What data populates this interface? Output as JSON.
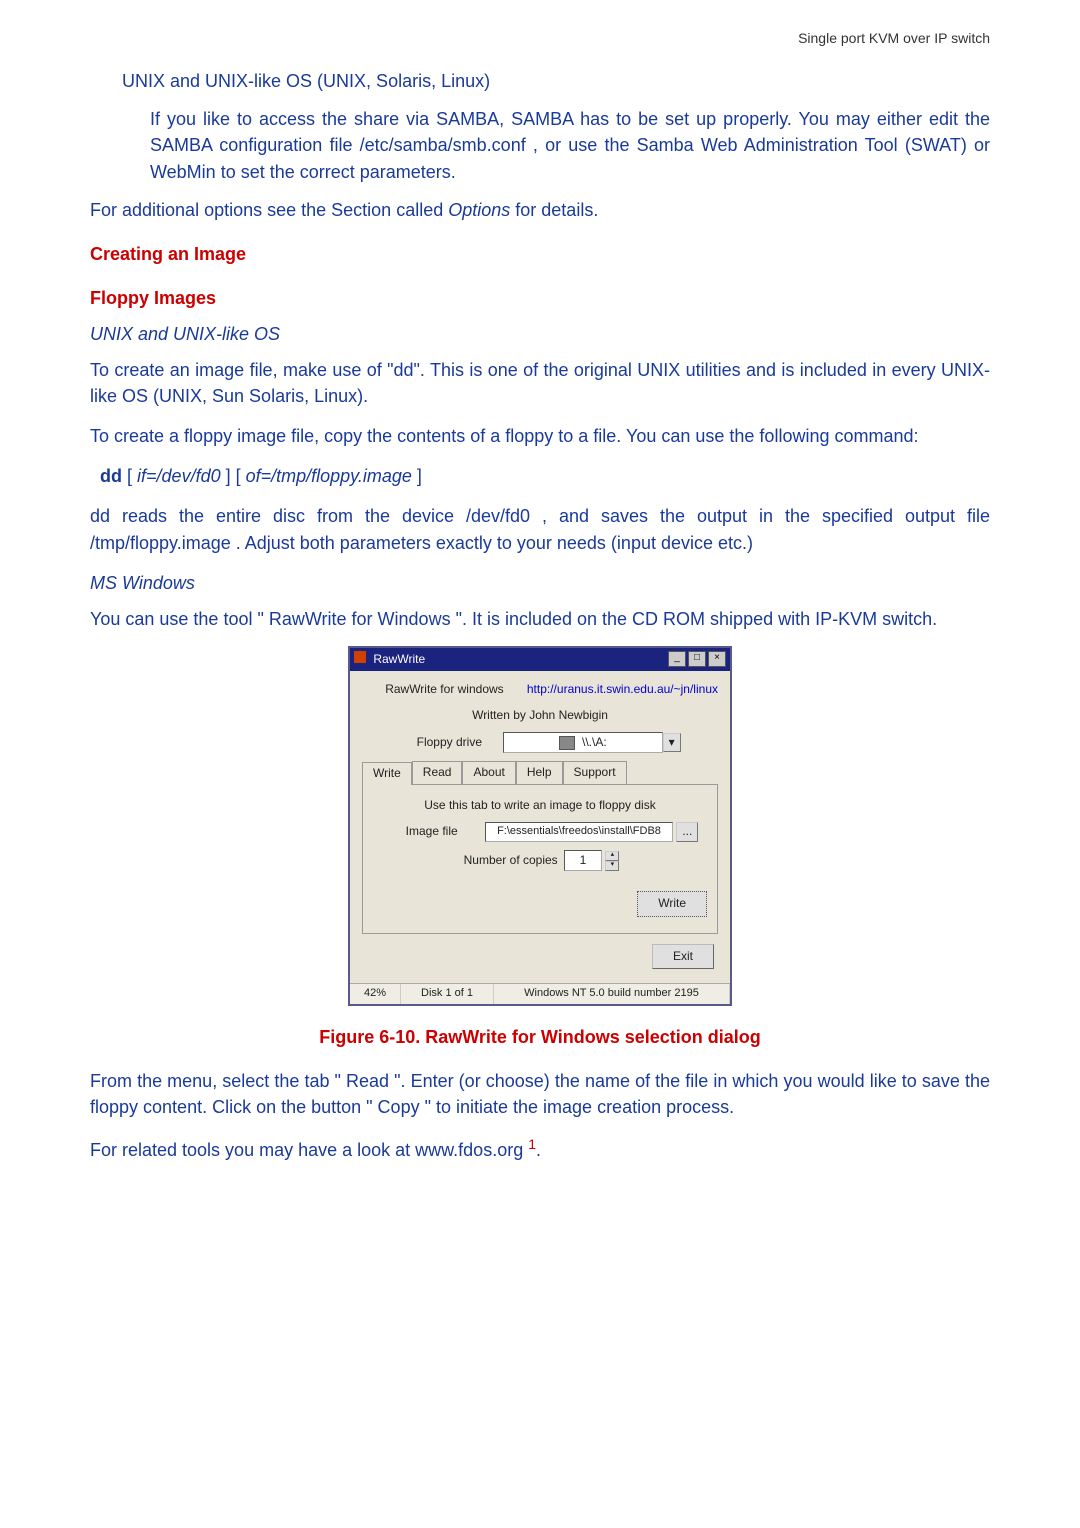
{
  "header": "Single port KVM over IP switch",
  "unix_heading": "UNIX and UNIX-like OS (UNIX, Solaris, Linux)",
  "samba_para": "If you like to access the share via SAMBA, SAMBA has to be set up properly. You may either edit the SAMBA configuration file /etc/samba/smb.conf , or use the Samba Web Administration Tool (SWAT) or WebMin to set the correct parameters.",
  "options_para_pre": "For additional options see the Section called ",
  "options_word": "Options",
  "options_para_post": " for details.",
  "creating_heading": "Creating an Image",
  "floppy_heading": "Floppy Images",
  "unix_sub": "UNIX and UNIX-like OS",
  "dd_para1": "To create an image file, make use of \"dd\". This is one of the original UNIX utilities and is included in every UNIX-like OS (UNIX, Sun Solaris, Linux).",
  "dd_para2": "To create a floppy image file, copy the contents of a floppy to a file. You can use the following command:",
  "dd_cmd_bold": "dd",
  "dd_cmd_if": "if=/dev/fd0",
  "dd_cmd_of": "of=/tmp/floppy.image",
  "dd_explain": " dd reads the entire disc from the device /dev/fd0 , and saves the output in the specified output file /tmp/floppy.image . Adjust both parameters exactly to your needs (input device etc.)",
  "mswin_sub": "MS Windows",
  "rawwrite_para": "You can use the tool \" RawWrite for Windows \". It is included on the CD ROM shipped with IP-KVM switch.",
  "figure_caption": "Figure 6-10. RawWrite for Windows selection dialog",
  "read_para": "From the menu, select the tab \" Read \". Enter (or choose) the name of the file in which you would like to save the floppy content. Click on the button \" Copy \" to initiate the image creation process.",
  "fdos_para_pre": "For related tools you may have a look at www.fdos.org ",
  "fdos_sup": "1",
  "fdos_para_post": ".",
  "dialog": {
    "title": "RawWrite",
    "line1": "RawWrite for windows",
    "url": "http://uranus.it.swin.edu.au/~jn/linux",
    "author": "Written by John Newbigin",
    "floppy_label": "Floppy drive",
    "floppy_value": "\\\\.\\A:",
    "tabs": {
      "write": "Write",
      "read": "Read",
      "about": "About",
      "help": "Help",
      "support": "Support"
    },
    "tab_hint": "Use this tab to write an image to floppy disk",
    "image_label": "Image file",
    "image_value": "F:\\essentials\\freedos\\install\\FDB8",
    "copies_label": "Number of copies",
    "copies_value": "1",
    "write_btn": "Write",
    "exit_btn": "Exit",
    "status_pct": "42%",
    "status_disk": "Disk 1 of 1",
    "status_build": "Windows NT 5.0 build number 2195"
  }
}
